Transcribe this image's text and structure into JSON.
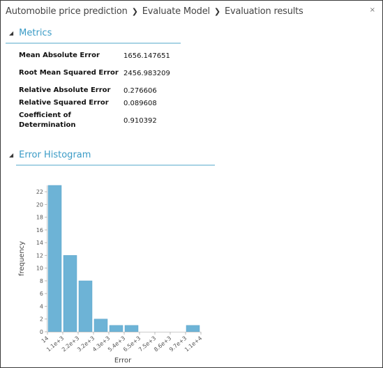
{
  "header": {
    "breadcrumb": [
      "Automobile price prediction",
      "Evaluate Model",
      "Evaluation results"
    ],
    "separator": "❯",
    "close_icon": "×"
  },
  "metrics_section": {
    "title": "Metrics",
    "collapse_icon": "◢",
    "rows": [
      {
        "name": "Mean Absolute Error",
        "value": "1656.147651"
      },
      {
        "name": "Root Mean Squared Error",
        "value": "2456.983209"
      },
      {
        "name": "Relative Absolute Error",
        "value": "0.276606"
      },
      {
        "name": "Relative Squared Error",
        "value": "0.089608"
      },
      {
        "name": "Coefficient of Determination",
        "value": "0.910392"
      }
    ]
  },
  "histogram_section": {
    "title": "Error Histogram",
    "collapse_icon": "◢"
  },
  "chart_data": {
    "type": "bar",
    "title": "Error Histogram",
    "xlabel": "Error",
    "ylabel": "frequency",
    "categories": [
      "14",
      "1.1e+3",
      "2.2e+3",
      "3.2e+3",
      "4.3e+3",
      "5.4e+3",
      "6.5e+3",
      "7.5e+3",
      "8.6e+3",
      "9.7e+3",
      "1.1e+4"
    ],
    "values": [
      23,
      12,
      8,
      2,
      1,
      1,
      0,
      0,
      0,
      1
    ],
    "yticks": [
      0,
      2,
      4,
      6,
      8,
      10,
      12,
      14,
      16,
      18,
      20,
      22
    ],
    "ylim": [
      0,
      23
    ],
    "bar_color": "#6db3d6",
    "grid": false
  }
}
